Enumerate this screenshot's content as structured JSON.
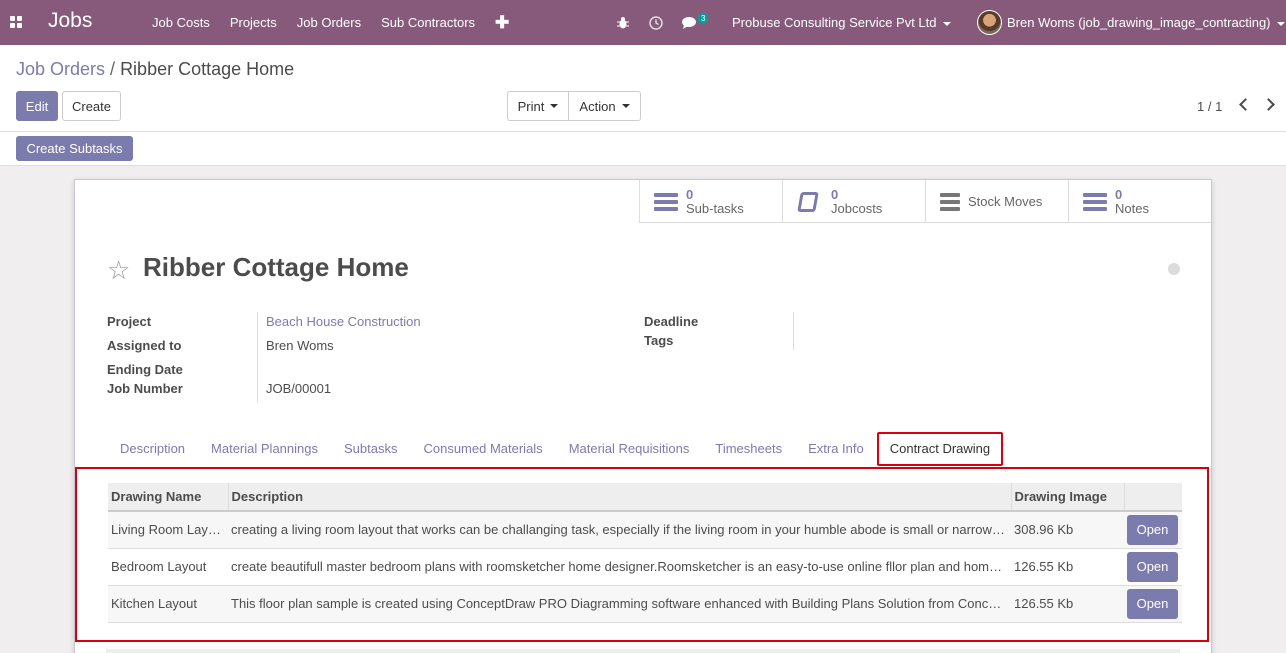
{
  "navbar": {
    "app_title": "Jobs",
    "menu": [
      "Job Costs",
      "Projects",
      "Job Orders",
      "Sub Contractors"
    ],
    "chat_count": "3",
    "company": "Probuse Consulting Service Pvt Ltd",
    "user": "Bren Woms (job_drawing_image_contracting)"
  },
  "breadcrumb": {
    "parent": "Job Orders",
    "current": "Ribber Cottage Home"
  },
  "buttons": {
    "edit": "Edit",
    "create": "Create",
    "print": "Print",
    "action": "Action",
    "create_subtasks": "Create Subtasks"
  },
  "pager": "1 / 1",
  "smart_buttons": [
    {
      "count": "0",
      "label": "Sub-tasks"
    },
    {
      "count": "0",
      "label": "Jobcosts"
    },
    {
      "count": "",
      "label": "Stock Moves"
    },
    {
      "count": "0",
      "label": "Notes"
    }
  ],
  "record": {
    "title": "Ribber Cottage Home",
    "fields_left": [
      {
        "label": "Project",
        "value": "Beach House Construction"
      },
      {
        "label": "Assigned to",
        "value": "Bren Woms"
      },
      {
        "label": "Ending Date",
        "value": ""
      },
      {
        "label": "Job Number",
        "value": "JOB/00001"
      }
    ],
    "fields_right": [
      {
        "label": "Deadline",
        "value": ""
      },
      {
        "label": "Tags",
        "value": ""
      }
    ]
  },
  "tabs": [
    "Description",
    "Material Plannings",
    "Subtasks",
    "Consumed Materials",
    "Material Requisitions",
    "Timesheets",
    "Extra Info",
    "Contract Drawing"
  ],
  "active_tab": "Contract Drawing",
  "drawings": {
    "columns": [
      "Drawing Name",
      "Description",
      "Drawing Image",
      ""
    ],
    "rows": [
      {
        "name": "Living Room Layout",
        "description": "creating a living room layout that works can be challanging task, especially if the living room in your humble abode is small or narrow…",
        "image": "308.96 Kb",
        "action": "Open"
      },
      {
        "name": "Bedroom Layout",
        "description": "create beautifull master bedroom plans with roomsketcher home designer.Roomsketcher is an easy-to-use online fllor plan and hom…",
        "image": "126.55 Kb",
        "action": "Open"
      },
      {
        "name": "Kitchen Layout",
        "description": "This floor plan sample is created using ConceptDraw PRO Diagramming software enhanced with Building Plans Solution from Conc…",
        "image": "126.55 Kb",
        "action": "Open"
      }
    ]
  },
  "colors": {
    "primary": "#875a7b",
    "accent": "#7c7bad",
    "highlight": "#d9000d"
  }
}
